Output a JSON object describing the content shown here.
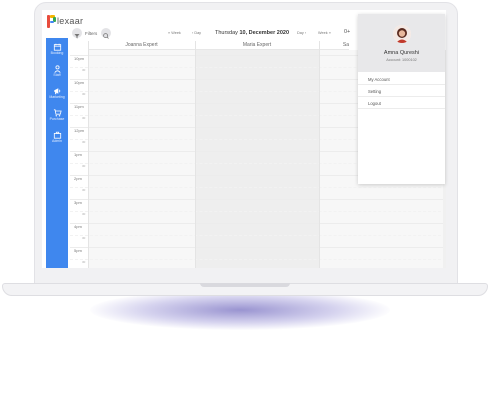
{
  "brand": {
    "logo_text": "lexaar",
    "accent": "#3f87ee"
  },
  "sidebar": {
    "items": [
      {
        "label": "Booking",
        "icon": "calendar-icon"
      },
      {
        "label": "Staff",
        "icon": "user-icon"
      },
      {
        "label": "Marketing",
        "icon": "megaphone-icon"
      },
      {
        "label": "Purchase",
        "icon": "cart-icon"
      },
      {
        "label": "Admin",
        "icon": "briefcase-icon"
      }
    ]
  },
  "toolbar": {
    "filters_label": "Filters",
    "week_label": "Week",
    "prev_label": "Day",
    "date_weekday": "Thursday",
    "date_main": "10, December 2020",
    "next_label": "Day",
    "view_label": "Week",
    "add_label": "0+"
  },
  "calendar": {
    "columns": [
      "Joanna Expert",
      "Maria Expert",
      "Sa"
    ],
    "times": [
      "10pm",
      "10pm",
      "11pm",
      "12pm",
      "1pm",
      "2pm",
      "3pm",
      "4pm",
      "5pm"
    ],
    "half_label": "30"
  },
  "profile_menu": {
    "name": "Amna Qureshi",
    "account": "Account: 1000102",
    "items": [
      "My Account",
      "Setting",
      "Logout"
    ]
  }
}
